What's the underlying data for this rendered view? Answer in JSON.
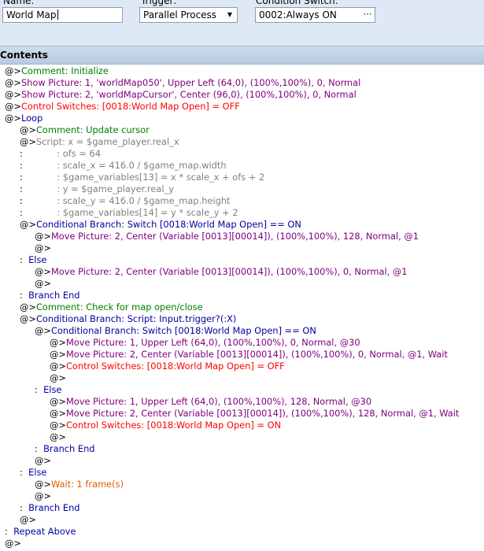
{
  "header": {
    "name_label": "Name:",
    "trigger_label": "Trigger:",
    "condition_label": "Condition Switch:",
    "name_value": "World Map",
    "trigger_value": "Parallel Process",
    "condition_value": "0002:Always ON"
  },
  "contents": {
    "title": "Contents",
    "lines": [
      {
        "indent": 0,
        "prefix": "@>",
        "text": "Comment: Initialize",
        "kind": "comment"
      },
      {
        "indent": 0,
        "prefix": "@>",
        "text": "Show Picture: 1, 'worldMap050', Upper Left (64,0), (100%,100%), 0, Normal",
        "kind": "picture"
      },
      {
        "indent": 0,
        "prefix": "@>",
        "text": "Show Picture: 2, 'worldMapCursor', Center (96,0), (100%,100%), 0, Normal",
        "kind": "picture"
      },
      {
        "indent": 0,
        "prefix": "@>",
        "text": "Control Switches: [0018:World Map Open] = OFF",
        "kind": "switch"
      },
      {
        "indent": 0,
        "prefix": "@>",
        "text": "Loop",
        "kind": "flow"
      },
      {
        "indent": 1,
        "prefix": "@>",
        "text": "Comment: Update cursor",
        "kind": "comment"
      },
      {
        "indent": 1,
        "prefix": "@>",
        "text": "Script: x = $game_player.real_x",
        "kind": "script"
      },
      {
        "indent": 1,
        "prefix": " :",
        "text": "            : ofs = 64",
        "kind": "script"
      },
      {
        "indent": 1,
        "prefix": " :",
        "text": "            : scale_x = 416.0 / $game_map.width",
        "kind": "script"
      },
      {
        "indent": 1,
        "prefix": " :",
        "text": "            : $game_variables[13] = x * scale_x + ofs + 2",
        "kind": "script"
      },
      {
        "indent": 1,
        "prefix": " :",
        "text": "            : y = $game_player.real_y",
        "kind": "script"
      },
      {
        "indent": 1,
        "prefix": " :",
        "text": "            : scale_y = 416.0 / $game_map.height",
        "kind": "script"
      },
      {
        "indent": 1,
        "prefix": " :",
        "text": "            : $game_variables[14] = y * scale_y + 2",
        "kind": "script"
      },
      {
        "indent": 1,
        "prefix": "@>",
        "text": "Conditional Branch: Switch [0018:World Map Open] == ON",
        "kind": "flow"
      },
      {
        "indent": 2,
        "prefix": "@>",
        "text": "Move Picture: 2, Center (Variable [0013][00014]), (100%,100%), 128, Normal, @1",
        "kind": "picture"
      },
      {
        "indent": 2,
        "prefix": "@>",
        "text": "",
        "kind": "plain"
      },
      {
        "indent": 1,
        "prefix": " :",
        "text": "  Else",
        "kind": "flow"
      },
      {
        "indent": 2,
        "prefix": "@>",
        "text": "Move Picture: 2, Center (Variable [0013][00014]), (100%,100%), 0, Normal, @1",
        "kind": "picture"
      },
      {
        "indent": 2,
        "prefix": "@>",
        "text": "",
        "kind": "plain"
      },
      {
        "indent": 1,
        "prefix": " :",
        "text": "  Branch End",
        "kind": "flow"
      },
      {
        "indent": 1,
        "prefix": "@>",
        "text": "Comment: Check for map open/close",
        "kind": "comment"
      },
      {
        "indent": 1,
        "prefix": "@>",
        "text": "Conditional Branch: Script: Input.trigger?(:X)",
        "kind": "flow"
      },
      {
        "indent": 2,
        "prefix": "@>",
        "text": "Conditional Branch: Switch [0018:World Map Open] == ON",
        "kind": "flow"
      },
      {
        "indent": 3,
        "prefix": "@>",
        "text": "Move Picture: 1, Upper Left (64,0), (100%,100%), 0, Normal, @30",
        "kind": "picture"
      },
      {
        "indent": 3,
        "prefix": "@>",
        "text": "Move Picture: 2, Center (Variable [0013][00014]), (100%,100%), 0, Normal, @1, Wait",
        "kind": "picture"
      },
      {
        "indent": 3,
        "prefix": "@>",
        "text": "Control Switches: [0018:World Map Open] = OFF",
        "kind": "switch"
      },
      {
        "indent": 3,
        "prefix": "@>",
        "text": "",
        "kind": "plain"
      },
      {
        "indent": 2,
        "prefix": " :",
        "text": "  Else",
        "kind": "flow"
      },
      {
        "indent": 3,
        "prefix": "@>",
        "text": "Move Picture: 1, Upper Left (64,0), (100%,100%), 128, Normal, @30",
        "kind": "picture"
      },
      {
        "indent": 3,
        "prefix": "@>",
        "text": "Move Picture: 2, Center (Variable [0013][00014]), (100%,100%), 128, Normal, @1, Wait",
        "kind": "picture"
      },
      {
        "indent": 3,
        "prefix": "@>",
        "text": "Control Switches: [0018:World Map Open] = ON",
        "kind": "switch"
      },
      {
        "indent": 3,
        "prefix": "@>",
        "text": "",
        "kind": "plain"
      },
      {
        "indent": 2,
        "prefix": " :",
        "text": "  Branch End",
        "kind": "flow"
      },
      {
        "indent": 2,
        "prefix": "@>",
        "text": "",
        "kind": "plain"
      },
      {
        "indent": 1,
        "prefix": " :",
        "text": "  Else",
        "kind": "flow"
      },
      {
        "indent": 2,
        "prefix": "@>",
        "text": "Wait: 1 frame(s)",
        "kind": "wait"
      },
      {
        "indent": 2,
        "prefix": "@>",
        "text": "",
        "kind": "plain"
      },
      {
        "indent": 1,
        "prefix": " :",
        "text": "  Branch End",
        "kind": "flow"
      },
      {
        "indent": 1,
        "prefix": "@>",
        "text": "",
        "kind": "plain"
      },
      {
        "indent": 0,
        "prefix": " :",
        "text": "  Repeat Above",
        "kind": "flow"
      },
      {
        "indent": 0,
        "prefix": "@>",
        "text": "",
        "kind": "plain"
      }
    ]
  },
  "colors": {
    "comment": "#008000",
    "picture": "#800080",
    "switch": "#ff0000",
    "flow": "#0000a0",
    "script": "#808080",
    "wait": "#e06000",
    "header_bg": "#dfe8f5"
  }
}
